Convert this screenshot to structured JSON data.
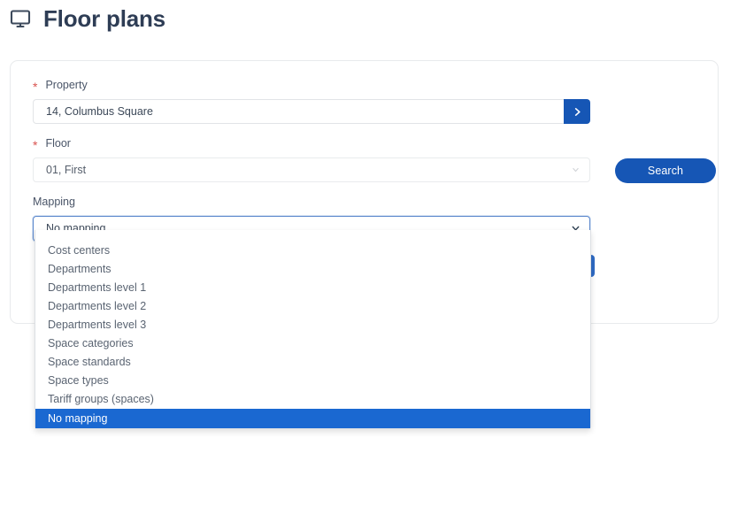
{
  "header": {
    "icon": "monitor-icon",
    "title": "Floor plans"
  },
  "form": {
    "property": {
      "label": "Property",
      "required_marker": "*",
      "value": "14, Columbus Square",
      "placeholder": "",
      "go_icon": "chevron-right-icon"
    },
    "floor": {
      "label": "Floor",
      "required_marker": "*",
      "value": "01, First",
      "caret_icon": "chevron-down-icon"
    },
    "mapping": {
      "label": "Mapping",
      "value": "No mapping",
      "caret_icon": "chevron-down-icon",
      "options": [
        "Cost centers",
        "Departments",
        "Departments level 1",
        "Departments level 2",
        "Departments level 3",
        "Space categories",
        "Space standards",
        "Space types",
        "Tariff groups (spaces)",
        "No mapping"
      ],
      "selected_option": "No mapping"
    },
    "search_label": "Search",
    "hidden_action_label": ""
  },
  "colors": {
    "primary_blue": "#1656b5",
    "highlight_blue": "#1a68d1",
    "focus_border": "#5b87cc",
    "required_red": "#d9534f",
    "title_color": "#2e3d55",
    "card_border": "#e8eaec"
  }
}
